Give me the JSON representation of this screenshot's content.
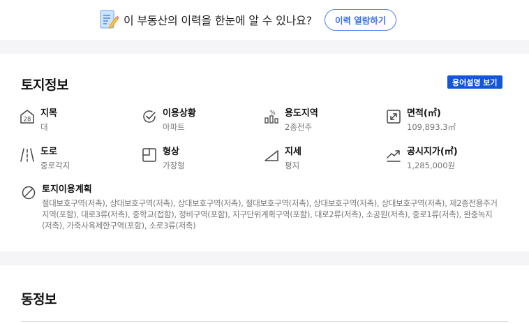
{
  "banner": {
    "question": "이 부동산의 이력을 한눈에 알 수 있나요?",
    "button_label": "이력 열람하기"
  },
  "land": {
    "title": "토지정보",
    "glossary_button": "용어설명 보기",
    "items": [
      {
        "label": "지목",
        "value": "대",
        "icon": "land-category-icon"
      },
      {
        "label": "이용상황",
        "value": "아파트",
        "icon": "check-circle-icon"
      },
      {
        "label": "용도지역",
        "value": "2종전주",
        "icon": "zoning-bar-icon"
      },
      {
        "label": "면적(㎡)",
        "value": "109,893.3㎡",
        "icon": "expand-area-icon"
      },
      {
        "label": "도로",
        "value": "중로각지",
        "icon": "road-icon"
      },
      {
        "label": "형상",
        "value": "가장형",
        "icon": "shape-square-icon"
      },
      {
        "label": "지세",
        "value": "평지",
        "icon": "terrain-slope-icon"
      },
      {
        "label": "공시지가(㎡)",
        "value": "1,285,000원",
        "icon": "trend-up-icon"
      }
    ],
    "plan": {
      "label": "토지이용계획",
      "value": "절대보호구역(저촉), 상대보호구역(저촉), 상대보호구역(저촉), 절대보호구역(저촉), 상대보호구역(저촉), 상대보호구역(저촉), 제2종전용주거지역(포함), 대로3류(저촉), 중학교(접함), 정비구역(포함), 지구단위계획구역(포함), 대로2류(저촉), 소공원(저촉), 중로1류(저촉), 완충녹지(저촉), 가축사육제한구역(포함), 소로3류(저촉)",
      "icon": "no-entry-icon"
    }
  },
  "building": {
    "title": "동정보"
  },
  "colors": {
    "accent": "#3a6ee8",
    "glossary_bg": "#1356d6",
    "background": "#f5f5f7"
  }
}
